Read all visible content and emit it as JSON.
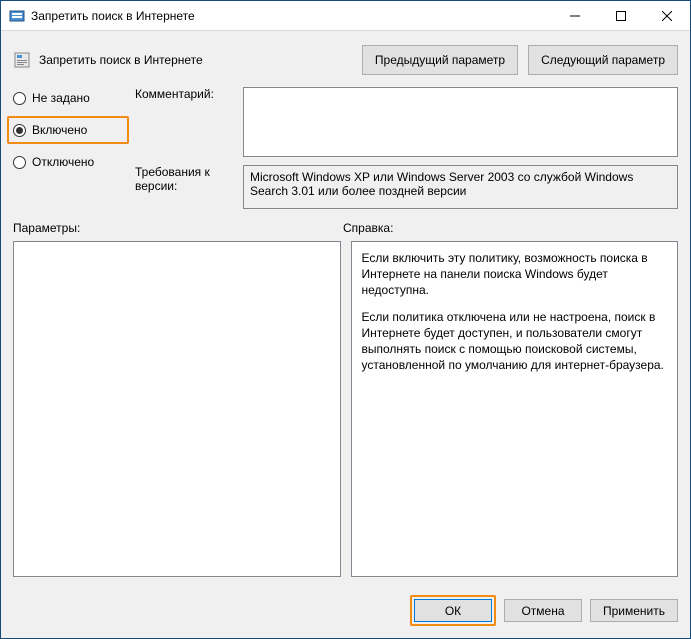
{
  "window": {
    "title": "Запретить поиск в Интернете"
  },
  "header": {
    "title": "Запретить поиск в Интернете",
    "prev_button": "Предыдущий параметр",
    "next_button": "Следующий параметр"
  },
  "state": {
    "options": {
      "not_configured": "Не задано",
      "enabled": "Включено",
      "disabled": "Отключено"
    },
    "selected": "enabled"
  },
  "fields": {
    "comment_label": "Комментарий:",
    "comment_value": "",
    "requirements_label": "Требования к версии:",
    "requirements_value": "Microsoft Windows XP или Windows Server 2003 со службой Windows Search 3.01 или более поздней версии"
  },
  "labels": {
    "parameters": "Параметры:",
    "help": "Справка:"
  },
  "help": {
    "p1": "Если включить эту политику, возможность поиска в Интернете на панели поиска Windows будет недоступна.",
    "p2": "Если политика отключена или не настроена, поиск в Интернете будет доступен, и пользователи смогут выполнять поиск с помощью поисковой системы, установленной по умолчанию для интернет-браузера."
  },
  "footer": {
    "ok": "ОК",
    "cancel": "Отмена",
    "apply": "Применить"
  }
}
